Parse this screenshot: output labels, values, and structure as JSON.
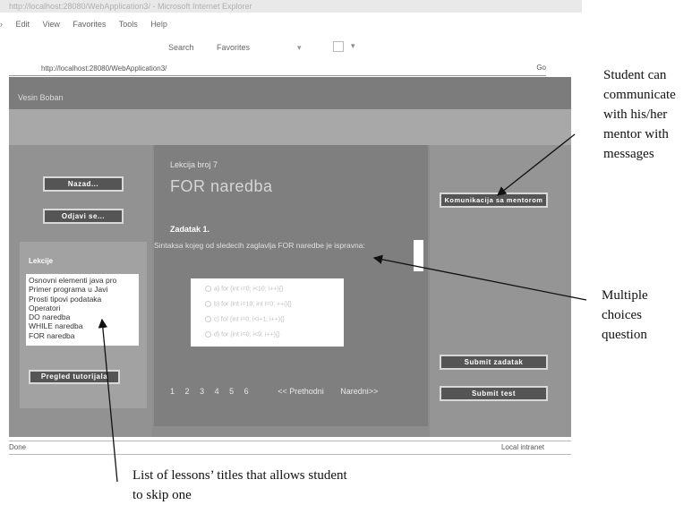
{
  "browser": {
    "title": "http://localhost:28080/WebApplication3/ - Microsoft Internet Explorer",
    "menu": [
      "Edit",
      "View",
      "Favorites",
      "Tools",
      "Help"
    ],
    "toolbar": {
      "search": "Search",
      "favorites": "Favorites"
    },
    "address": "http://localhost:28080/WebApplication3/",
    "go": "Go",
    "status_left": "Done",
    "status_right": "Local intranet"
  },
  "app": {
    "user_name": "Vesin Boban",
    "btn_back": "Nazad...",
    "btn_logout": "Odjavi se...",
    "lessons_label": "Lekcije",
    "lessons": [
      "Osnovni elementi java pro",
      "Primer programa u Javi",
      "Prosti tipovi podataka",
      "Operatori",
      "DO naredba",
      "WHILE naredba",
      "FOR naredba"
    ],
    "btn_tutorials": "Pregled tutorijala",
    "lesson_number": "Lekcija broj 7",
    "lesson_title": "FOR naredba",
    "task_label": "Zadatak 1.",
    "question": "Sintaksa kojeg od sledecih zaglavlja FOR naredbe je ispravna:",
    "choices": [
      "a) for (int i=0; i<10; i++){}",
      "b) for (int i=10; int i=0; ++i){}",
      "c) for (int i=0; i<i+1; i++){}",
      "d) for (int i=0; i<9; i++){}"
    ],
    "pages": [
      "1",
      "2",
      "3",
      "4",
      "5",
      "6"
    ],
    "prev": "<< Prethodni",
    "next": "Naredni>>",
    "btn_mentor": "Komunikacija sa mentorom",
    "btn_submit_task": "Submit zadatak",
    "btn_submit_test": "Submit test"
  },
  "annotations": {
    "mentor": [
      "Student can",
      "communicate",
      "with his/her",
      "mentor with",
      "messages"
    ],
    "mcq": [
      "Multiple",
      "choices",
      "question"
    ],
    "list": [
      "List of   lessons’ titles that allows student",
      "to skip one"
    ]
  }
}
